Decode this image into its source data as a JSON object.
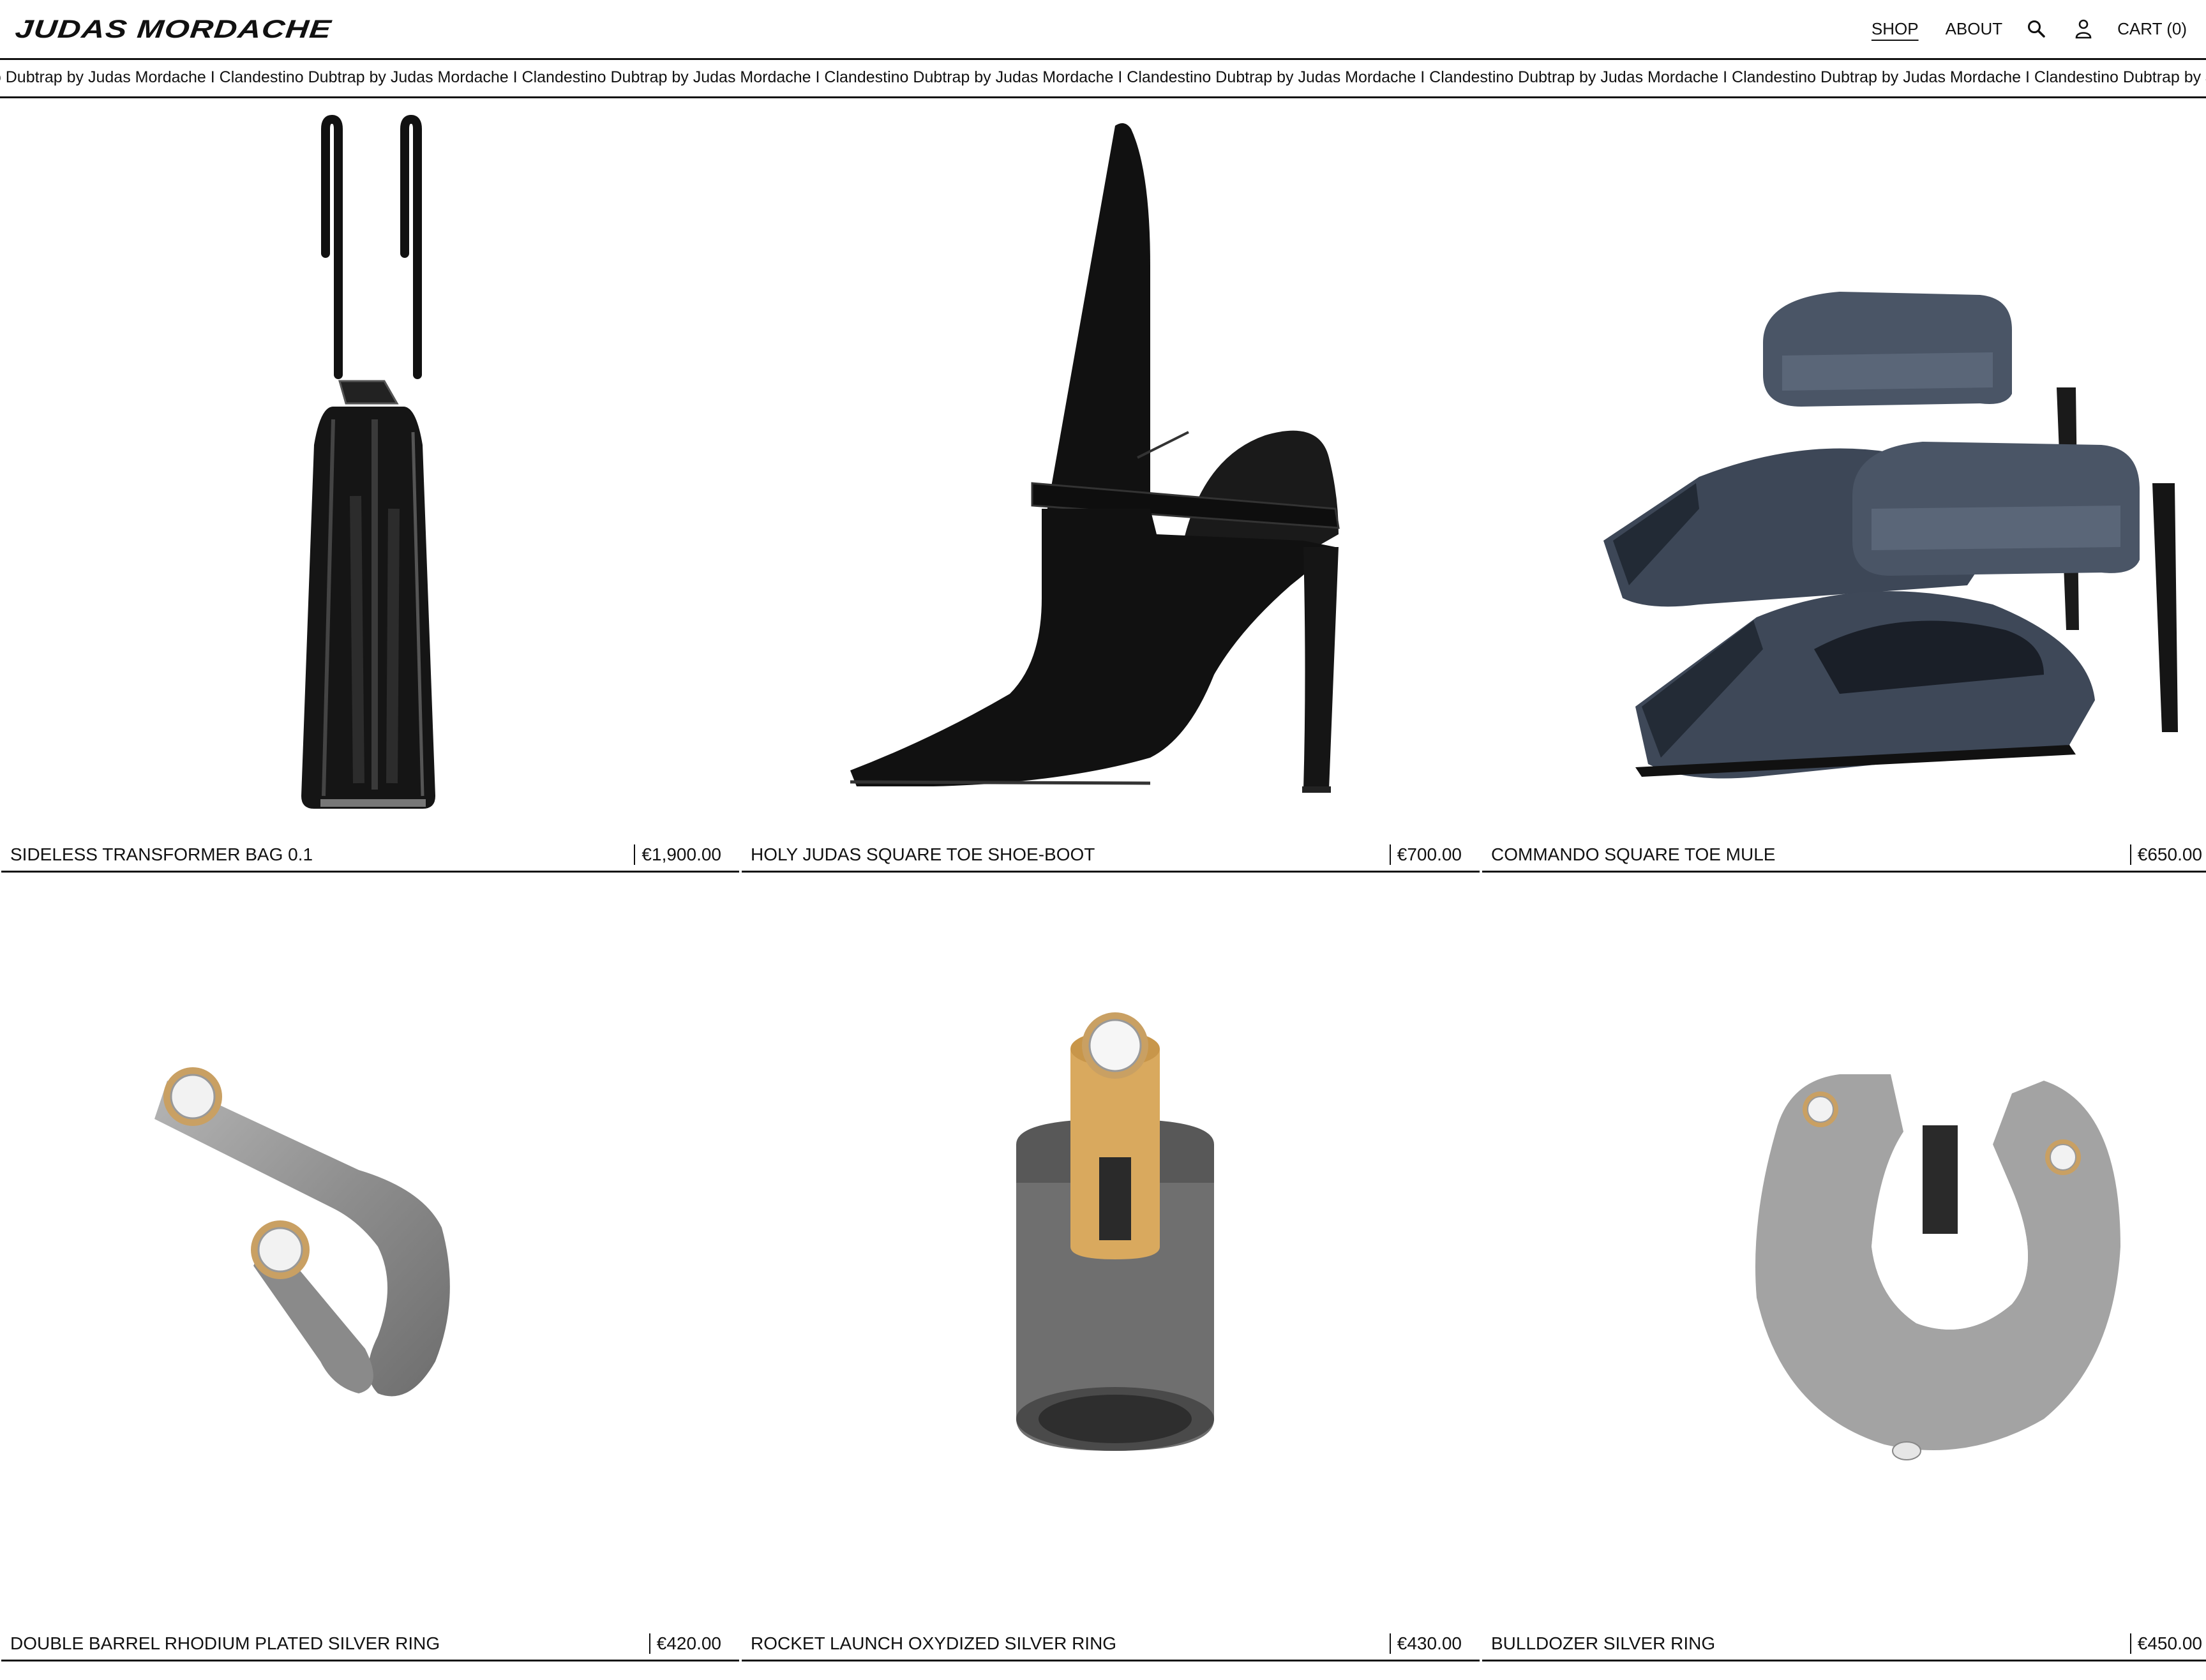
{
  "header": {
    "logo": "JUDAS MORDACHE",
    "nav": {
      "shop": "SHOP",
      "about": "ABOUT",
      "cart": "CART (0)"
    },
    "icons": [
      "search-icon",
      "account-icon"
    ]
  },
  "marquee": {
    "text": "Clandestino Dubtrap by Judas Mordache",
    "separator": " I ",
    "visible": "no Dubtrap by Judas Mordache I Clandestino Dubtrap by Judas Mordache I Clandestino Dubtrap by Judas Mordache I Clandestino Dubtrap by Judas Mordache I Clandestino Dubtrap by Judas Mordache I Clandestino Dubtrap by Judas Mordache I Clandestino Dubtrap by Judas Mordache I Clandestino Dubtrap by Judas Mordache I Clandestino Dubtrap by Judas Mord"
  },
  "products": [
    {
      "name": "SIDELESS TRANSFORMER BAG 0.1",
      "price": "€1,900.00",
      "image": "bag"
    },
    {
      "name": "HOLY JUDAS SQUARE TOE SHOE-BOOT",
      "price": "€700.00",
      "image": "boot"
    },
    {
      "name": "COMMANDO SQUARE TOE MULE",
      "price": "€650.00",
      "image": "mule"
    },
    {
      "name": "DOUBLE BARREL RHODIUM PLATED SILVER RING",
      "price": "€420.00",
      "image": "ring-double-barrel"
    },
    {
      "name": "ROCKET LAUNCH OXYDIZED SILVER RING",
      "price": "€430.00",
      "image": "ring-rocket"
    },
    {
      "name": "BULLDOZER SILVER RING",
      "price": "€450.00",
      "image": "ring-bulldozer"
    }
  ],
  "colors": {
    "text": "#111111",
    "background": "#ffffff",
    "mule": "#4a5566",
    "silver": "#9a9a9a",
    "gold": "#c9a063"
  }
}
